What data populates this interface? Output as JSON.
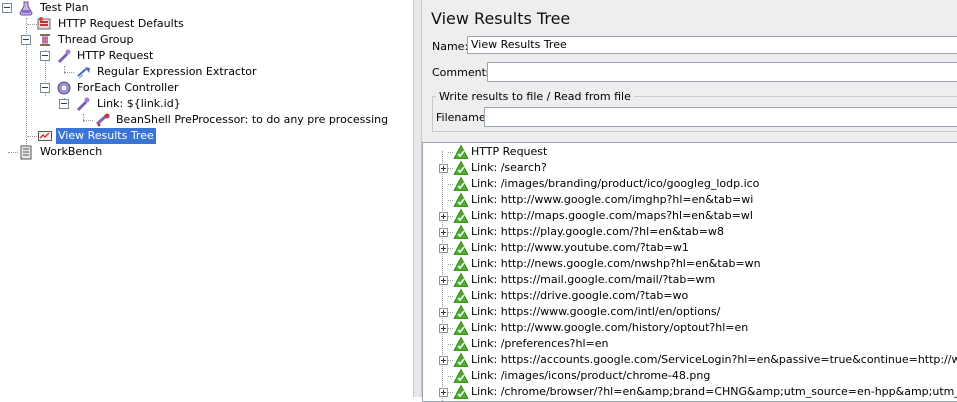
{
  "left_tree": {
    "items": [
      {
        "label": "Test Plan",
        "icon": "flask-icon",
        "name": "test-plan"
      },
      {
        "label": "HTTP Request Defaults",
        "icon": "config-icon",
        "name": "http-request-defaults"
      },
      {
        "label": "Thread Group",
        "icon": "spool-icon",
        "name": "thread-group"
      },
      {
        "label": "HTTP Request",
        "icon": "pipette-icon",
        "name": "http-request"
      },
      {
        "label": "Regular Expression Extractor",
        "icon": "extractor-icon",
        "name": "regex-extractor"
      },
      {
        "label": "ForEach Controller",
        "icon": "gear-icon",
        "name": "foreach-controller"
      },
      {
        "label": "Link: ${link.id}",
        "icon": "pipette-icon",
        "name": "link-sampler"
      },
      {
        "label": "BeanShell PreProcessor: to do any pre processing",
        "icon": "preprocessor-icon",
        "name": "beanshell-preprocessor"
      },
      {
        "label": "View Results Tree",
        "icon": "monitor-icon",
        "name": "view-results-tree",
        "selected": true
      },
      {
        "label": "WorkBench",
        "icon": "clipboard-icon",
        "name": "workbench"
      }
    ]
  },
  "panel": {
    "title": "View Results Tree",
    "name_label": "Name:",
    "name_value": "View Results Tree",
    "comments_label": "Comments:",
    "file_group_title": "Write results to file / Read from file",
    "filename_label": "Filename",
    "filename_value": ""
  },
  "results": [
    {
      "text": "HTTP Request",
      "expandable": false
    },
    {
      "text": "Link: /search?",
      "expandable": true
    },
    {
      "text": "Link: /images/branding/product/ico/googleg_lodp.ico",
      "expandable": false
    },
    {
      "text": "Link: http://www.google.com/imghp?hl=en&tab=wi",
      "expandable": false
    },
    {
      "text": "Link: http://maps.google.com/maps?hl=en&tab=wl",
      "expandable": true
    },
    {
      "text": "Link: https://play.google.com/?hl=en&tab=w8",
      "expandable": true
    },
    {
      "text": "Link: http://www.youtube.com/?tab=w1",
      "expandable": true
    },
    {
      "text": "Link: http://news.google.com/nwshp?hl=en&tab=wn",
      "expandable": false
    },
    {
      "text": "Link: https://mail.google.com/mail/?tab=wm",
      "expandable": true
    },
    {
      "text": "Link: https://drive.google.com/?tab=wo",
      "expandable": false
    },
    {
      "text": "Link: https://www.google.com/intl/en/options/",
      "expandable": true
    },
    {
      "text": "Link: http://www.google.com/history/optout?hl=en",
      "expandable": true
    },
    {
      "text": "Link: /preferences?hl=en",
      "expandable": false
    },
    {
      "text": "Link: https://accounts.google.com/ServiceLogin?hl=en&passive=true&continue=http://www.google.c",
      "expandable": true
    },
    {
      "text": "Link: /images/icons/product/chrome-48.png",
      "expandable": false
    },
    {
      "text": "Link: /chrome/browser/?hl=en&amp;brand=CHNG&amp;utm_source=en-hpp&amp;utm_medium=hpp&",
      "expandable": true
    }
  ],
  "colors": {
    "success_icon": "#4caf2a",
    "selection": "#3875d7",
    "panel_bg": "#eeeeee"
  }
}
